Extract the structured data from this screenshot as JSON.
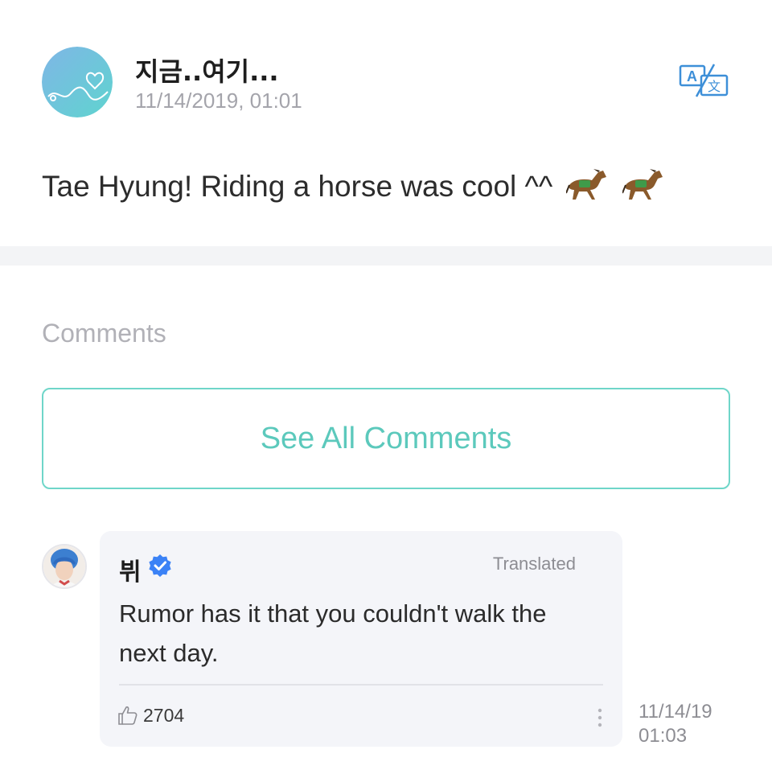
{
  "post": {
    "author": "지금..여기...",
    "date": "11/14/2019, 01:01",
    "text": "Tae Hyung! Riding a horse was cool ^^",
    "emoji": [
      "horse-emoji",
      "horse-emoji"
    ],
    "translate_icon": "translate-icon"
  },
  "comments": {
    "heading": "Comments",
    "see_all_label": "See All Comments",
    "items": [
      {
        "author": "뷔",
        "verified": true,
        "translated_label": "Translated",
        "text": "Rumor has it that you couldn't walk the next day.",
        "likes": "2704",
        "date": "11/14/19",
        "time": "01:03"
      }
    ]
  },
  "colors": {
    "accent": "#5cc9bc",
    "verified": "#3b82f6",
    "translate_icon": "#3d8fd8",
    "bubble": "#f4f5f9",
    "divider": "#f3f4f6"
  }
}
